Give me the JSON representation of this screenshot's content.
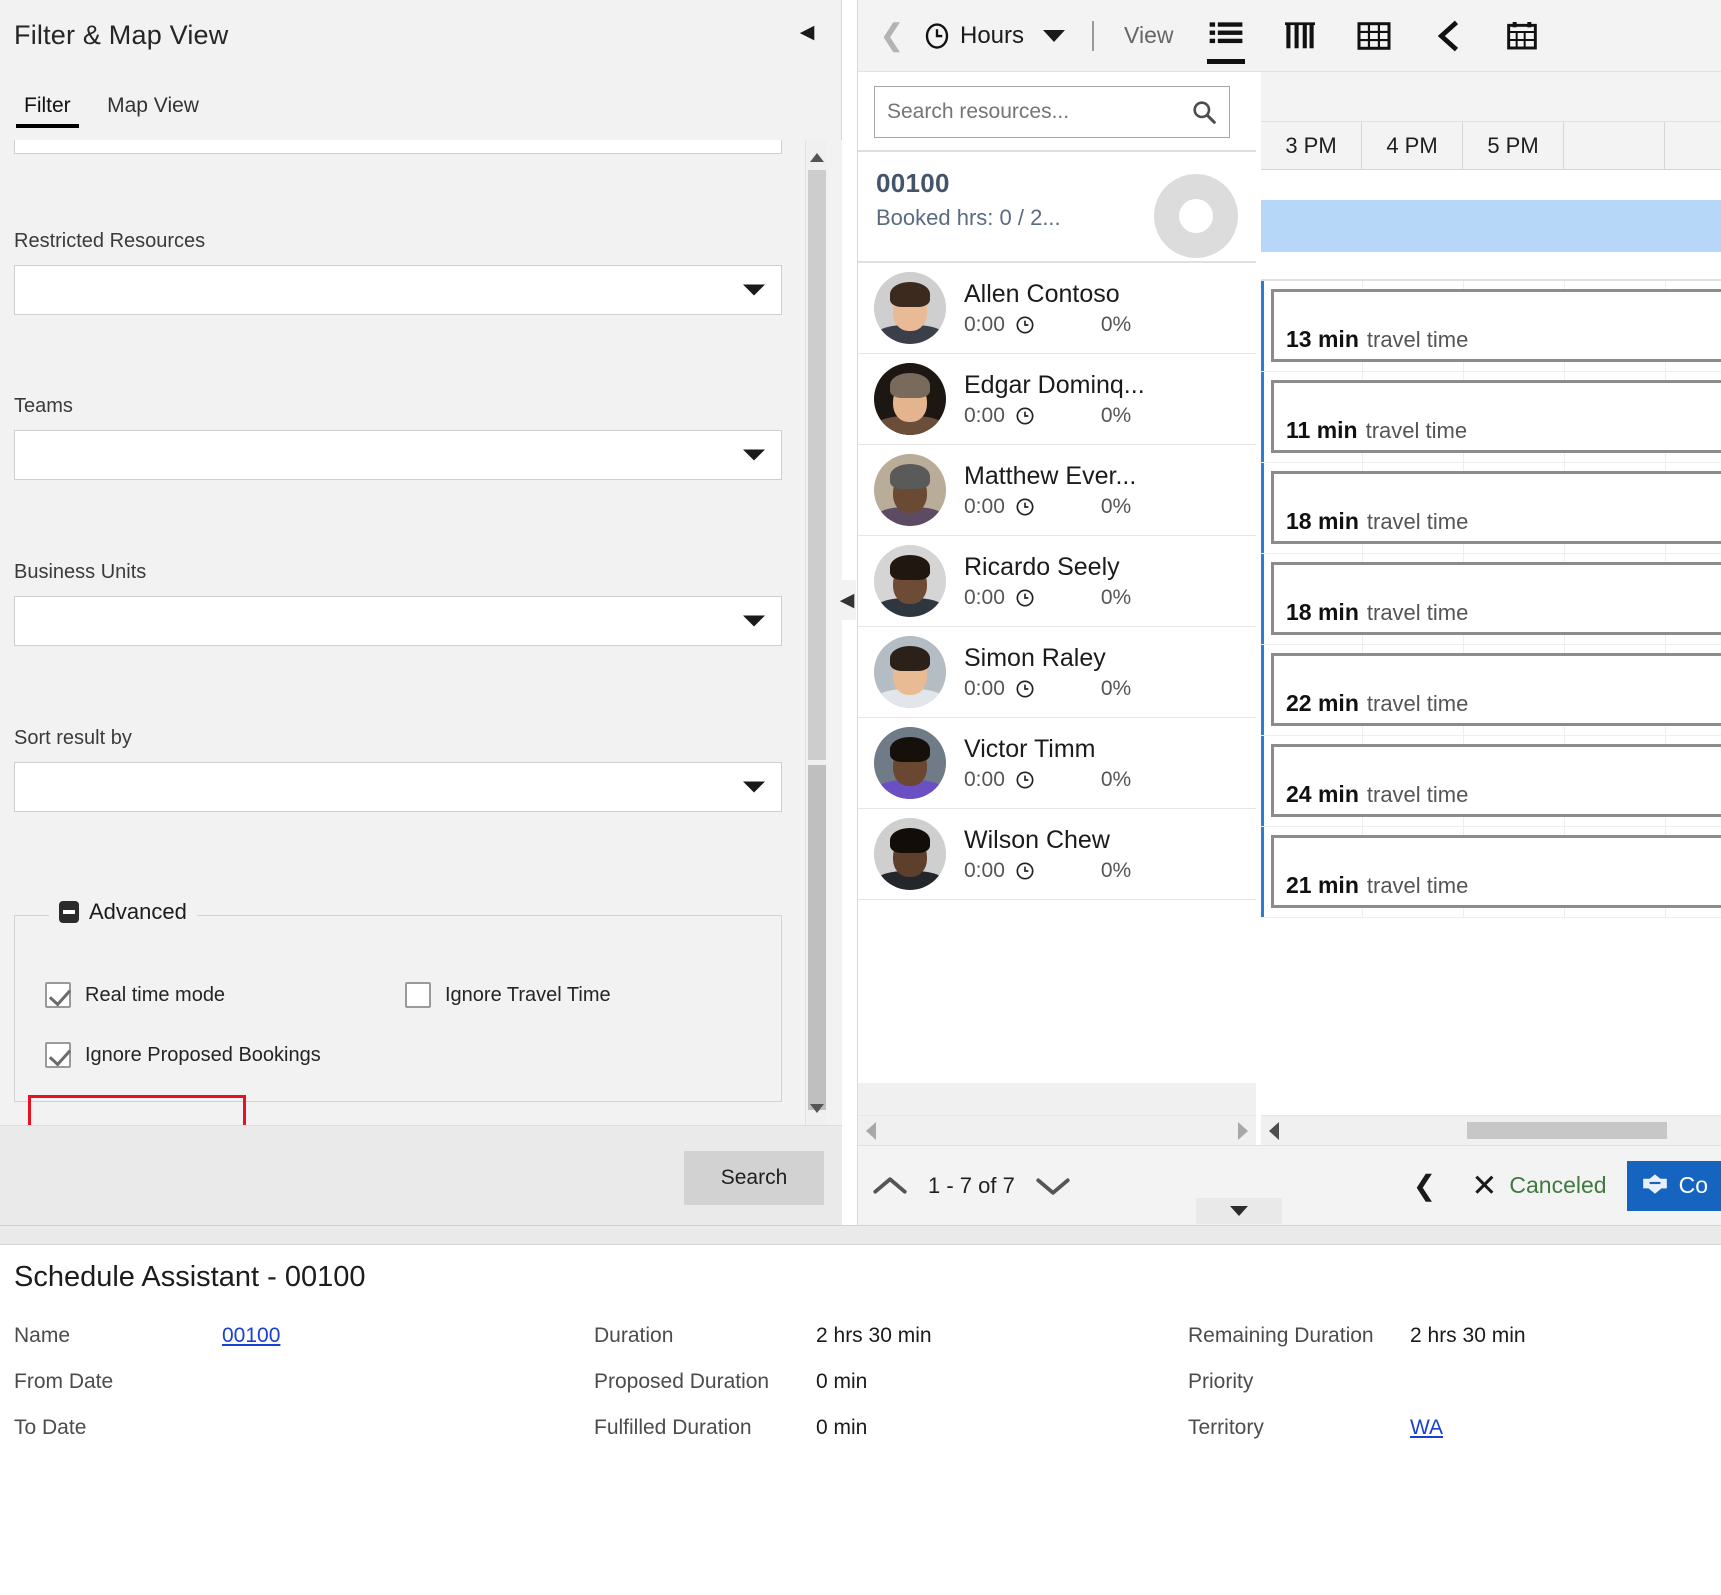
{
  "filter_panel": {
    "title": "Filter & Map View",
    "collapse_icon": "chevron-left-icon",
    "tabs": [
      {
        "label": "Filter",
        "active": true
      },
      {
        "label": "Map View",
        "active": false
      }
    ],
    "fields": [
      {
        "label": "Restricted Resources",
        "value": "",
        "icon": "chevron-down-icon"
      },
      {
        "label": "Teams",
        "value": "",
        "icon": "chevron-down-icon"
      },
      {
        "label": "Business Units",
        "value": "",
        "icon": "chevron-down-icon"
      },
      {
        "label": "Sort result by",
        "value": "",
        "icon": "chevron-down-icon"
      }
    ],
    "advanced": {
      "legend": "Advanced",
      "toggle_icon": "collapse-minus-icon",
      "checkboxes": [
        {
          "label": "Real time mode",
          "checked": true,
          "highlighted": true
        },
        {
          "label": "Ignore Travel Time",
          "checked": false,
          "highlighted": false
        },
        {
          "label": "Ignore Proposed Bookings",
          "checked": true,
          "highlighted": false
        }
      ],
      "highlight_color": "#e81123"
    },
    "footer": {
      "search_label": "Search"
    }
  },
  "schedule": {
    "toolbar": {
      "back_icon": "chevron-left-icon",
      "clock_icon": "clock-icon",
      "unit_label": "Hours",
      "unit_caret_icon": "caret-down-icon",
      "view_label": "View",
      "icons": [
        {
          "name": "list-view-icon",
          "active": true
        },
        {
          "name": "gantt-view-icon",
          "active": false
        },
        {
          "name": "grid-view-icon",
          "active": false
        },
        {
          "name": "chevron-left-icon",
          "active": false
        },
        {
          "name": "calendar-icon",
          "active": false
        }
      ]
    },
    "resource_search": {
      "placeholder": "Search resources...",
      "value": "",
      "icon": "search-icon"
    },
    "requirement": {
      "code": "00100",
      "booked": "Booked hrs: 0 / 2...",
      "avatar_icon": "placeholder-avatar-icon"
    },
    "resources": [
      {
        "name": "Allen Contoso",
        "hours": "0:00",
        "percent": "0%",
        "clock_icon": "clock-icon"
      },
      {
        "name": "Edgar Dominq...",
        "hours": "0:00",
        "percent": "0%",
        "clock_icon": "clock-icon"
      },
      {
        "name": "Matthew Ever...",
        "hours": "0:00",
        "percent": "0%",
        "clock_icon": "clock-icon"
      },
      {
        "name": "Ricardo Seely",
        "hours": "0:00",
        "percent": "0%",
        "clock_icon": "clock-icon"
      },
      {
        "name": "Simon Raley",
        "hours": "0:00",
        "percent": "0%",
        "clock_icon": "clock-icon"
      },
      {
        "name": "Victor Timm",
        "hours": "0:00",
        "percent": "0%",
        "clock_icon": "clock-icon"
      },
      {
        "name": "Wilson Chew",
        "hours": "0:00",
        "percent": "0%",
        "clock_icon": "clock-icon"
      }
    ],
    "timeline": {
      "hours": [
        "3 PM",
        "4 PM",
        "5 PM"
      ],
      "highlight_color": "#b6d7f7",
      "travel_times": [
        {
          "minutes": "13 min",
          "label": "travel time"
        },
        {
          "minutes": "11 min",
          "label": "travel time"
        },
        {
          "minutes": "18 min",
          "label": "travel time"
        },
        {
          "minutes": "18 min",
          "label": "travel time"
        },
        {
          "minutes": "22 min",
          "label": "travel time"
        },
        {
          "minutes": "24 min",
          "label": "travel time"
        },
        {
          "minutes": "21 min",
          "label": "travel time"
        }
      ]
    },
    "footer": {
      "prev_icon": "chevron-up-icon",
      "pagination": "1 - 7 of 7",
      "next_icon": "chevron-down-icon",
      "back_icon": "chevron-left-icon",
      "cancel_icon": "close-x-icon",
      "cancel_label": "Canceled",
      "commit_icon": "handshake-icon",
      "commit_label": "Co",
      "commit_color": "#1565c0"
    }
  },
  "detail": {
    "title": "Schedule Assistant - 00100",
    "rows": [
      {
        "label1": "Name",
        "value1": "00100",
        "value1_link": true,
        "label2": "Duration",
        "value2": "2 hrs 30 min",
        "label3": "Remaining Duration",
        "value3": "2 hrs 30 min",
        "value3_link": false
      },
      {
        "label1": "From Date",
        "value1": "",
        "value1_link": false,
        "label2": "Proposed Duration",
        "value2": "0 min",
        "label3": "Priority",
        "value3": "",
        "value3_link": false
      },
      {
        "label1": "To Date",
        "value1": "",
        "value1_link": false,
        "label2": "Fulfilled Duration",
        "value2": "0 min",
        "label3": "Territory",
        "value3": "WA",
        "value3_link": true
      }
    ]
  }
}
